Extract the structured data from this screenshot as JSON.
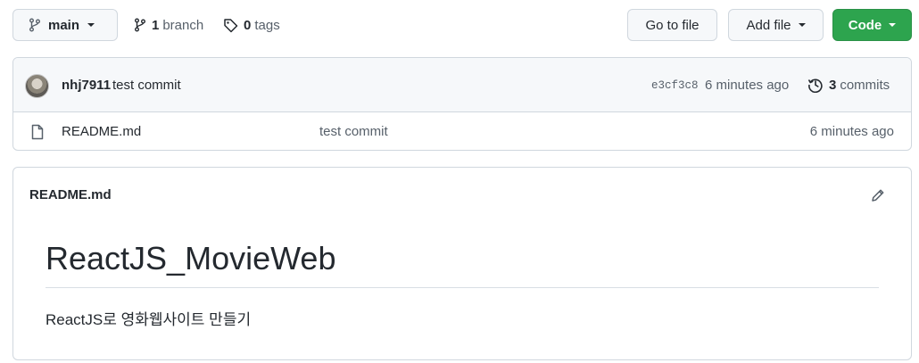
{
  "toolbar": {
    "branch_button_label": "main",
    "branches_count": "1",
    "branches_label": "branch",
    "tags_count": "0",
    "tags_label": "tags",
    "goto_file_label": "Go to file",
    "add_file_label": "Add file",
    "code_label": "Code"
  },
  "latest_commit": {
    "author": "nhj7911",
    "message": "test commit",
    "sha": "e3cf3c8",
    "time": "6 minutes ago",
    "commits_count": "3",
    "commits_label": "commits"
  },
  "files": [
    {
      "name": "README.md",
      "commit_message": "test commit",
      "time": "6 minutes ago"
    }
  ],
  "readme": {
    "filename": "README.md",
    "heading": "ReactJS_MovieWeb",
    "paragraph": "ReactJS로 영화웹사이트 만들기"
  },
  "colors": {
    "accent_green": "#2da44e",
    "border": "#d0d7de",
    "muted_text": "#57606a"
  },
  "icons": {
    "branch": "git-branch-icon",
    "tag": "tag-icon",
    "history": "history-icon",
    "file": "file-icon",
    "edit": "pencil-icon"
  }
}
